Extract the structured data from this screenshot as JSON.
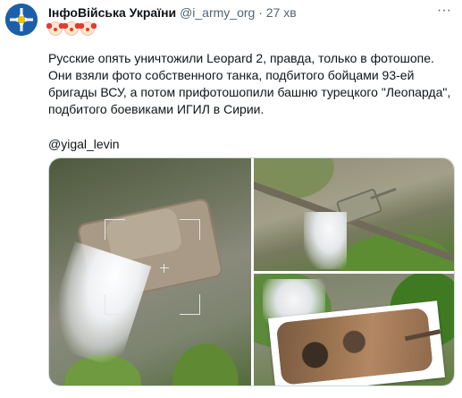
{
  "tweet": {
    "author_name": "ІнфоВійська України",
    "handle": "@i_army_org",
    "separator": "·",
    "time": "27 хв",
    "more_label": "···",
    "emoji_status": [
      "clown-face",
      "clown-face",
      "clown-face"
    ],
    "body_text": "Русские опять уничтожили Leopard 2, правда, только в фотошопе. Они взяли фото собственного танка, подбитого бойцами 93-ей бригады ВСУ, а потом прифотошопили башню турецкого \"Леопарда\", подбитого боевиками ИГИЛ в Сирии.",
    "mention": "@yigal_levin",
    "media": [
      {
        "icon": "drone-footage-tank-smoke",
        "position": "left-full"
      },
      {
        "icon": "aerial-tank-smoke",
        "position": "top-right"
      },
      {
        "icon": "tank-with-inset-photo",
        "position": "bottom-right"
      }
    ]
  },
  "colors": {
    "text": "#0f1419",
    "secondary": "#536471",
    "border": "#cfd9de",
    "avatar_bg": "#1c5fa8"
  }
}
